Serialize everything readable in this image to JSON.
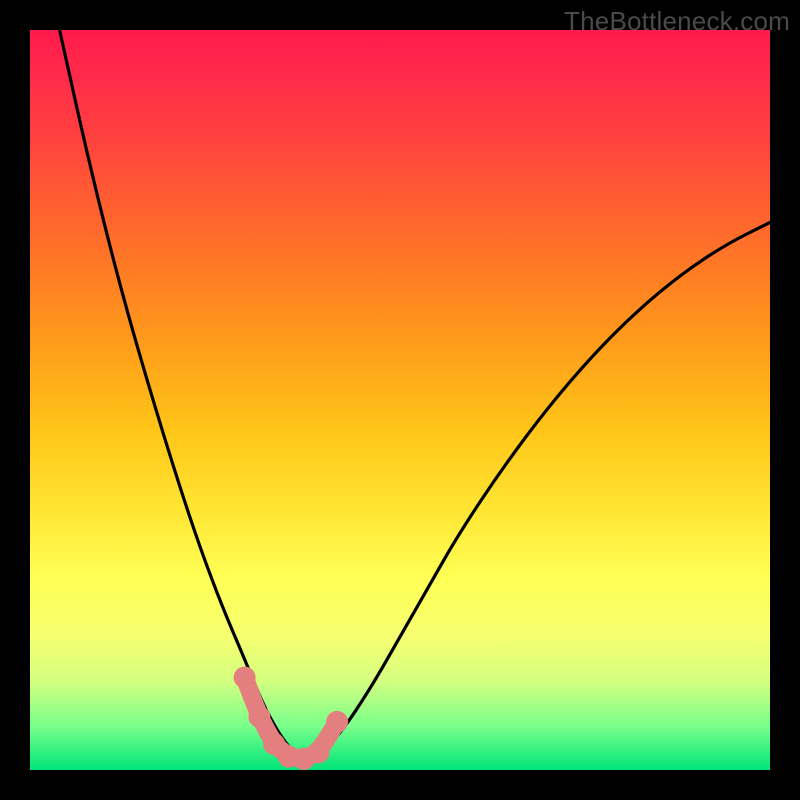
{
  "watermark": "TheBottleneck.com",
  "chart_data": {
    "type": "line",
    "title": "",
    "xlabel": "",
    "ylabel": "",
    "xlim": [
      0,
      1
    ],
    "ylim": [
      0,
      1
    ],
    "series": [
      {
        "name": "bottleneck-curve",
        "x": [
          0.04,
          0.08,
          0.12,
          0.16,
          0.2,
          0.23,
          0.26,
          0.29,
          0.31,
          0.33,
          0.35,
          0.37,
          0.39,
          0.42,
          0.46,
          0.5,
          0.54,
          0.58,
          0.64,
          0.7,
          0.76,
          0.82,
          0.88,
          0.94,
          1.0
        ],
        "y": [
          1.0,
          0.82,
          0.66,
          0.52,
          0.39,
          0.3,
          0.22,
          0.15,
          0.1,
          0.06,
          0.03,
          0.015,
          0.02,
          0.05,
          0.11,
          0.18,
          0.25,
          0.32,
          0.41,
          0.49,
          0.56,
          0.62,
          0.67,
          0.71,
          0.74
        ]
      }
    ],
    "markers": {
      "name": "highlight-segment",
      "color": "#e37f7f",
      "x": [
        0.29,
        0.31,
        0.33,
        0.35,
        0.37,
        0.39,
        0.415
      ],
      "y": [
        0.125,
        0.072,
        0.035,
        0.018,
        0.015,
        0.024,
        0.065
      ]
    }
  }
}
